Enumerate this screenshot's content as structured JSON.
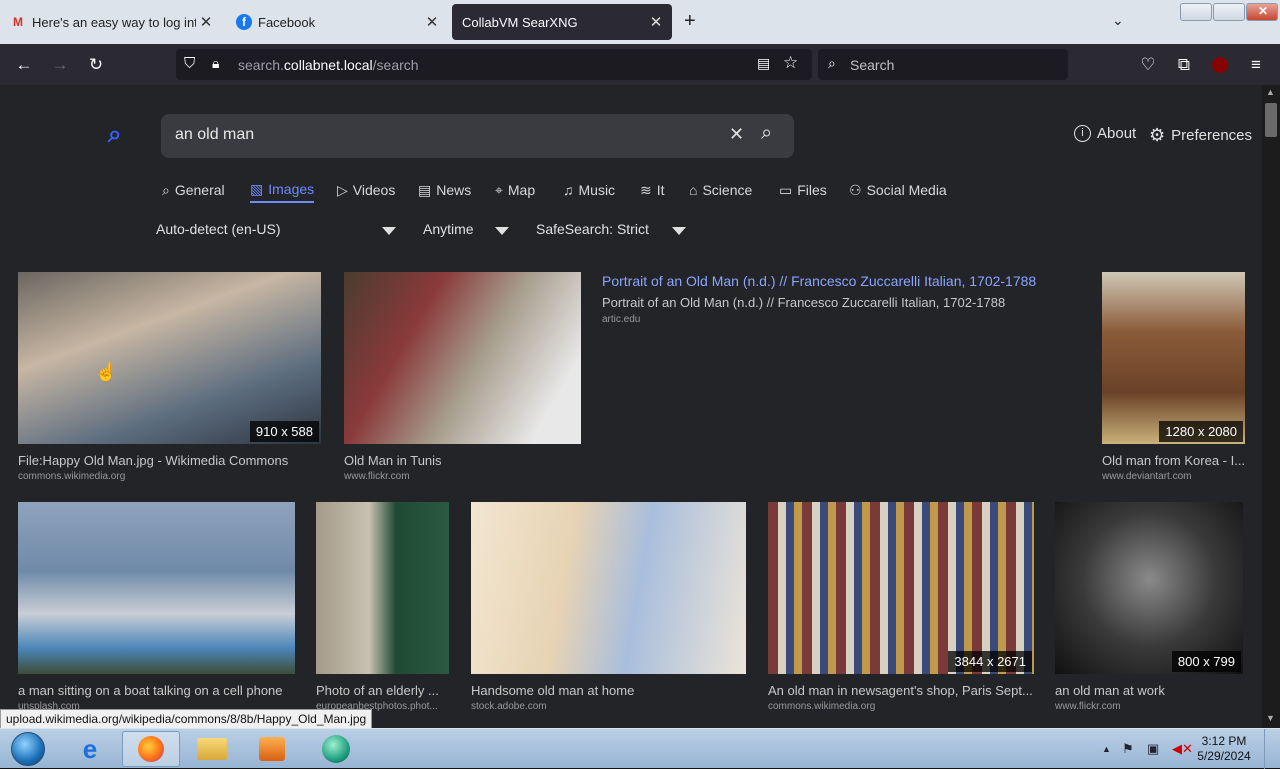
{
  "browser": {
    "tabs": [
      {
        "title": "Here's an easy way to log into F",
        "favicon": "gmail-icon",
        "active": false
      },
      {
        "title": "Facebook",
        "favicon": "facebook-icon",
        "active": false
      },
      {
        "title": "CollabVM SearXNG",
        "favicon": "",
        "active": true
      }
    ],
    "url_prefix": "search.",
    "url_domain": "collabnet.local",
    "url_path": "/search",
    "search_placeholder": "Search",
    "status_url": "upload.wikimedia.org/wikipedia/commons/8/8b/Happy_Old_Man.jpg"
  },
  "search": {
    "query": "an old man",
    "about_label": "About",
    "preferences_label": "Preferences"
  },
  "categories": [
    {
      "label": "General",
      "icon": "search-icon"
    },
    {
      "label": "Images",
      "icon": "image-icon",
      "active": true
    },
    {
      "label": "Videos",
      "icon": "play-icon"
    },
    {
      "label": "News",
      "icon": "newspaper-icon"
    },
    {
      "label": "Map",
      "icon": "map-pin-icon"
    },
    {
      "label": "Music",
      "icon": "music-icon"
    },
    {
      "label": "It",
      "icon": "layers-icon"
    },
    {
      "label": "Science",
      "icon": "graduation-cap-icon"
    },
    {
      "label": "Files",
      "icon": "archive-icon"
    },
    {
      "label": "Social Media",
      "icon": "people-icon"
    }
  ],
  "filters": {
    "language": "Auto-detect (en-US)",
    "time": "Anytime",
    "safesearch": "SafeSearch: Strict"
  },
  "results": [
    {
      "caption": "File:Happy Old Man.jpg - Wikimedia Commons",
      "source": "commons.wikimedia.org",
      "size": "910 x 588"
    },
    {
      "caption": "Old Man in Tunis",
      "source": "www.flickr.com",
      "size": ""
    },
    {
      "caption": "Portrait of an Old Man (n.d.) // Francesco Zuccarelli Italian, 1702-1788",
      "subtitle": "Portrait of an Old Man (n.d.) // Francesco Zuccarelli Italian, 1702-1788",
      "source": "artic.edu",
      "size": ""
    },
    {
      "caption": "Old man from Korea - I...",
      "source": "www.deviantart.com",
      "size": "1280 x 2080"
    },
    {
      "caption": "a man sitting on a boat talking on a cell phone",
      "source": "unsplash.com",
      "size": ""
    },
    {
      "caption": "Photo of an elderly ...",
      "source": "europeanbestphotos.phot...",
      "size": ""
    },
    {
      "caption": "Handsome old man at home",
      "source": "stock.adobe.com",
      "size": ""
    },
    {
      "caption": "An old man in newsagent's shop, Paris Sept...",
      "source": "commons.wikimedia.org",
      "size": "3844 x 2671"
    },
    {
      "caption": "an old man at work",
      "source": "www.flickr.com",
      "size": "800 x 799"
    }
  ],
  "taskbar": {
    "time": "3:12 PM",
    "date": "5/29/2024"
  }
}
